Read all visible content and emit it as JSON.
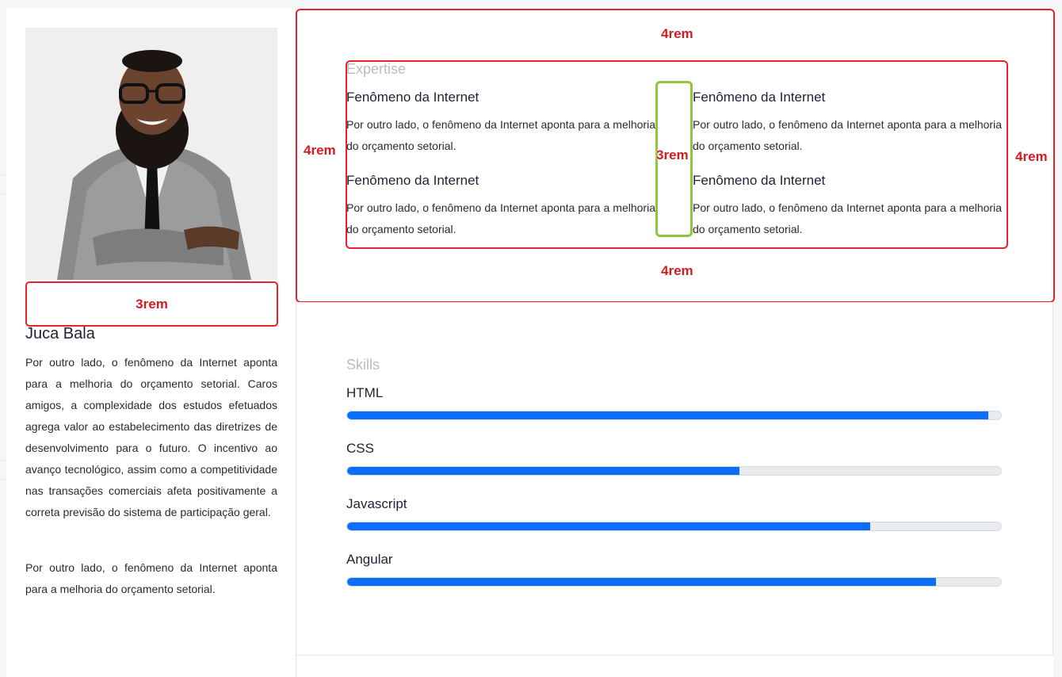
{
  "profile": {
    "name": "Juca Bala",
    "bio": [
      "Por outro lado, o fenômeno da Internet aponta para a melhoria do orçamento setorial. Caros amigos, a complexidade dos estudos efetuados agrega valor ao estabelecimento das diretrizes de desenvolvimento para o futuro. O incentivo ao avanço tecnológico, assim como a competitividade nas transações comerciais afeta positivamente a correta previsão do sistema de participação geral.",
      "Por outro lado, o fenômeno da Internet aponta para a melhoria do orçamento setorial."
    ]
  },
  "expertise": {
    "title": "Expertise",
    "items": [
      {
        "heading": "Fenômeno da Internet",
        "text": "Por outro lado, o fenômeno da Internet aponta para a melhoria do orçamento setorial."
      },
      {
        "heading": "Fenômeno da Internet",
        "text": "Por outro lado, o fenômeno da Internet aponta para a melhoria do orçamento setorial."
      },
      {
        "heading": "Fenômeno da Internet",
        "text": "Por outro lado, o fenômeno da Internet aponta para a melhoria do orçamento setorial."
      },
      {
        "heading": "Fenômeno da Internet",
        "text": "Por outro lado, o fenômeno da Internet aponta para a melhoria do orçamento setorial."
      }
    ]
  },
  "skills": {
    "title": "Skills",
    "items": [
      {
        "name": "HTML",
        "percent": 98
      },
      {
        "name": "CSS",
        "percent": 60
      },
      {
        "name": "Javascript",
        "percent": 80
      },
      {
        "name": "Angular",
        "percent": 90
      }
    ]
  },
  "annotations": {
    "top": "4rem",
    "bottom": "4rem",
    "left": "4rem",
    "right": "4rem",
    "column_gap": "3rem",
    "photo_gap": "3rem"
  },
  "colors": {
    "accent": "#0d6efd",
    "annotation_red": "#e8222a",
    "annotation_green": "#8dc63f"
  }
}
